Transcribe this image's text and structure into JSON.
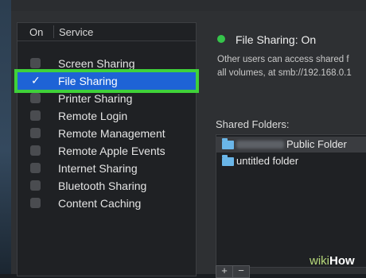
{
  "list": {
    "header_on": "On",
    "header_service": "Service",
    "services": [
      {
        "label": "Screen Sharing",
        "checked": false,
        "selected": false
      },
      {
        "label": "File Sharing",
        "checked": true,
        "selected": true
      },
      {
        "label": "Printer Sharing",
        "checked": false,
        "selected": false
      },
      {
        "label": "Remote Login",
        "checked": false,
        "selected": false
      },
      {
        "label": "Remote Management",
        "checked": false,
        "selected": false
      },
      {
        "label": "Remote Apple Events",
        "checked": false,
        "selected": false
      },
      {
        "label": "Internet Sharing",
        "checked": false,
        "selected": false
      },
      {
        "label": "Bluetooth Sharing",
        "checked": false,
        "selected": false
      },
      {
        "label": "Content Caching",
        "checked": false,
        "selected": false
      }
    ],
    "checkmark": "✓"
  },
  "status": {
    "text": "File Sharing: On",
    "color": "#35c44a",
    "description_line1": "Other users can access shared f",
    "description_line2": "all volumes, at smb://192.168.0.1"
  },
  "shared_folders": {
    "title": "Shared Folders:",
    "folders": [
      {
        "name": "Public Folder",
        "icon": "folder-icon",
        "selected": true
      },
      {
        "name": "untitled folder",
        "icon": "folder-icon",
        "selected": false
      }
    ],
    "add_label": "+",
    "remove_label": "−"
  },
  "watermark": {
    "wiki": "wiki",
    "how": "How"
  },
  "colors": {
    "selection": "#1e63d6",
    "highlight_outline": "#3fd13a",
    "folder": "#6ab6e8"
  }
}
